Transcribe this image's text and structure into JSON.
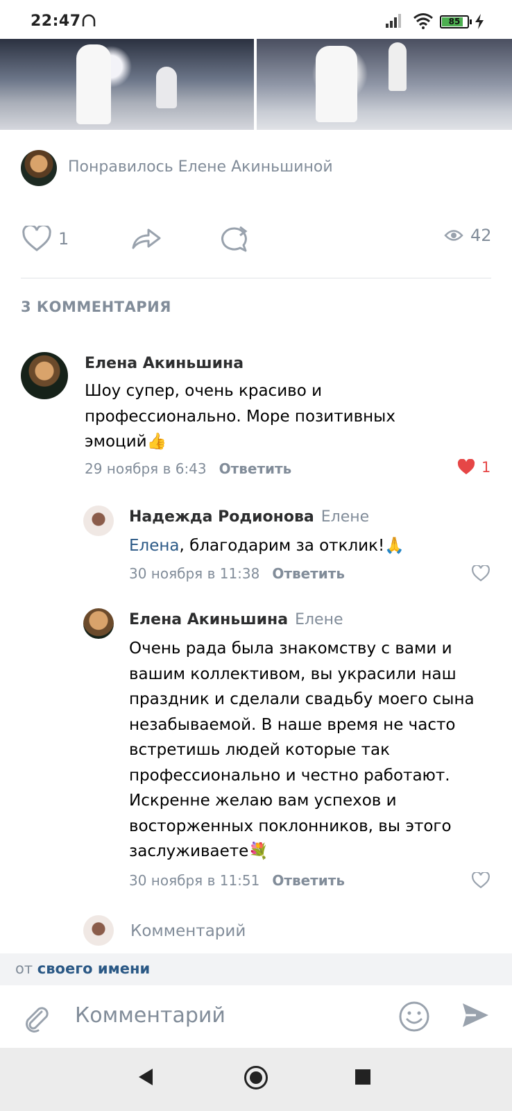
{
  "status_bar": {
    "time": "22:47",
    "battery": "85"
  },
  "post": {
    "liked_by_text": "Понравилось Елене Акиньшиной",
    "likes_count": "1",
    "views_count": "42"
  },
  "comments_header": "3 КОММЕНТАРИЯ",
  "comments": [
    {
      "author": "Елена Акиньшина",
      "reply_to": "",
      "mention": "",
      "text": "Шоу супер, очень красиво и профессионально. Море позитивных эмоций👍",
      "date": "29 ноября в 6:43",
      "reply_label": "Ответить",
      "likes": "1",
      "liked": true
    },
    {
      "author": "Надежда Родионова",
      "reply_to": "Елене",
      "mention": "Елена",
      "text": ", благодарим за отклик!🙏",
      "date": "30 ноября в 11:38",
      "reply_label": "Ответить",
      "likes": "",
      "liked": false
    },
    {
      "author": "Елена Акиньшина",
      "reply_to": "Елене",
      "mention": "",
      "text": "Очень рада была знакомству с вами и вашим коллективом, вы  украсили наш праздник и сделали свадьбу моего сына незабываемой. В наше время не часто встретишь людей которые так профессионально и честно работают. Искренне желаю вам успехов и восторженных поклонников, вы этого заслуживаете💐",
      "date": "30 ноября в 11:51",
      "reply_label": "Ответить",
      "likes": "",
      "liked": false
    }
  ],
  "inline_comment_placeholder": "Комментарий",
  "from_bar": {
    "prefix": "от",
    "link": "своего имени"
  },
  "compose": {
    "placeholder": "Комментарий"
  },
  "colors": {
    "link": "#2a5885",
    "secondary": "#818c99",
    "like_red": "#e64646"
  }
}
